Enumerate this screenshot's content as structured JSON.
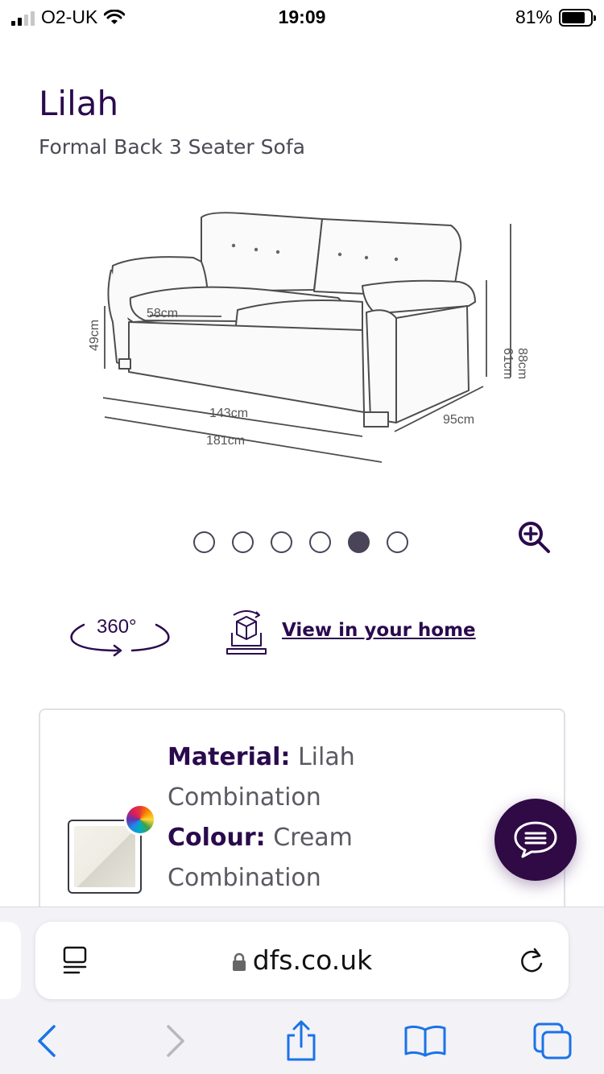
{
  "status_bar": {
    "carrier": "O2-UK",
    "time": "19:09",
    "battery": "81%",
    "battery_level": 0.81
  },
  "product": {
    "name": "Lilah",
    "subtitle": "Formal Back 3 Seater Sofa"
  },
  "dimension_labels": {
    "seat_depth": "58cm",
    "seat_height": "49cm",
    "arm_height": "61cm",
    "total_height": "88cm",
    "seat_width": "143cm",
    "total_width": "181cm",
    "depth": "95cm"
  },
  "carousel": {
    "total": 6,
    "active_index": 4
  },
  "actions": {
    "view360_label": "360°",
    "ar_link": "View in your home"
  },
  "material_card": {
    "material_label": "Material:",
    "material_value_1": "Lilah",
    "material_value_2": "Combination",
    "colour_label": "Colour:",
    "colour_value_1": "Cream",
    "colour_value_2": "Combination"
  },
  "browser": {
    "url": "dfs.co.uk"
  },
  "colors": {
    "brand_purple": "#2a0a4d",
    "chat_button": "#2f0a45",
    "ios_blue": "#1a73e8"
  }
}
